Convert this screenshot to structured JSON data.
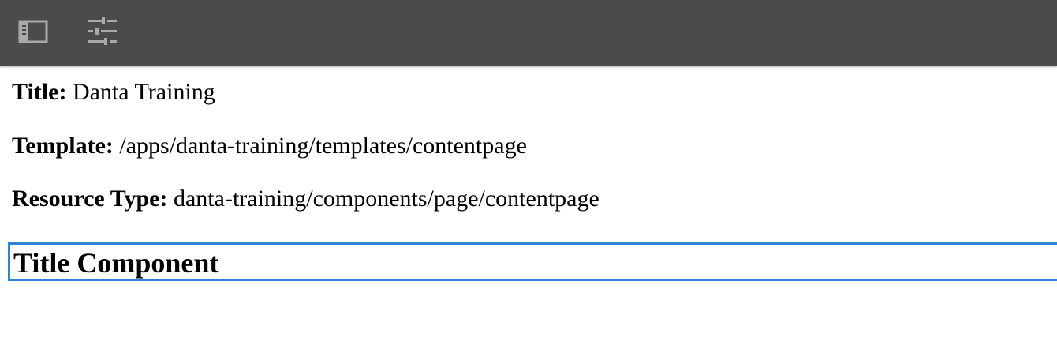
{
  "toolbar": {
    "buttons": [
      {
        "icon": "side-panel-icon"
      },
      {
        "icon": "page-properties-icon"
      }
    ],
    "background": "#4b4b4b",
    "icon_color": "#a9a9a9"
  },
  "page_info": {
    "title_label": "Title:",
    "title_value": "Danta Training",
    "template_label": "Template:",
    "template_value": "/apps/danta-training/templates/contentpage",
    "resource_type_label": "Resource Type:",
    "resource_type_value": "danta-training/components/page/contentpage"
  },
  "component": {
    "heading": "Title Component",
    "selection_color": "#2d82d2"
  }
}
